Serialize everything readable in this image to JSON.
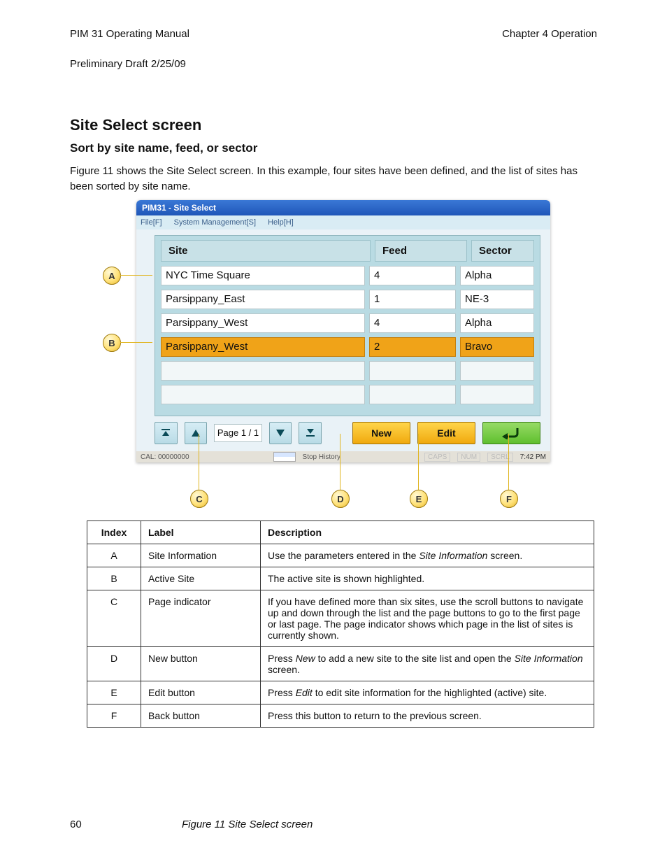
{
  "header": {
    "doc_title": "PIM 31 Operating Manual",
    "chapter": "Chapter 4   Operation",
    "doc_id": "Preliminary Draft 2/25/09"
  },
  "section": {
    "heading": "Site Select screen",
    "subheading": "Sort by site name, feed, or sector",
    "body1": "Figure 11 shows the Site Select screen. In this example, four sites have been defined, and the list of sites has",
    "body2": "been sorted by site name."
  },
  "window": {
    "title": "PIM31 - Site Select",
    "menus": {
      "file": "File[F]",
      "sys": "System Management[S]",
      "help": "Help[H]"
    },
    "columns": {
      "site": "Site",
      "feed": "Feed",
      "sector": "Sector"
    },
    "rows": [
      {
        "site": "NYC Time Square",
        "feed": "4",
        "sector": "Alpha",
        "selected": false
      },
      {
        "site": "Parsippany_East",
        "feed": "1",
        "sector": "NE-3",
        "selected": false
      },
      {
        "site": "Parsippany_West",
        "feed": "4",
        "sector": "Alpha",
        "selected": false
      },
      {
        "site": "Parsippany_West",
        "feed": "2",
        "sector": "Bravo",
        "selected": true
      },
      {
        "site": "",
        "feed": "",
        "sector": "",
        "empty": true
      },
      {
        "site": "",
        "feed": "",
        "sector": "",
        "empty": true
      }
    ],
    "pager": "Page 1 / 1",
    "buttons": {
      "new": "New",
      "edit": "Edit"
    },
    "status": {
      "cal": "CAL: 00000000",
      "stop": "Stop History",
      "caps": "CAPS",
      "num": "NUM",
      "scrl": "SCRL",
      "time": "7:42 PM"
    }
  },
  "callouts": {
    "columns": {
      "idx": "Index",
      "label": "Label",
      "desc": "Description"
    },
    "rows": [
      {
        "idx": "A",
        "label": "Site Information",
        "desc": "Use the parameters entered in the <span class='emph'>Site Information</span> screen."
      },
      {
        "idx": "B",
        "label": "Active Site",
        "desc": "The active site is shown highlighted."
      },
      {
        "idx": "C",
        "label": "Page indicator",
        "desc": "If you have defined more than six sites, use the scroll buttons to nav­igate up and down through the list and the page buttons to go to the first page or last page. The page indicator shows which page in the list of sites is currently shown."
      },
      {
        "idx": "D",
        "label": "New button",
        "desc": "Press <span class='emph'>New</span> to add a new site to the site list and open the <span class='emph'>Site Informa­tion</span> screen."
      },
      {
        "idx": "E",
        "label": "Edit button",
        "desc": "Press <span class='emph'>Edit</span> to edit site information for the highlighted (active) site."
      },
      {
        "idx": "F",
        "label": "Back button",
        "desc": "Press this button to return to the previous screen."
      }
    ]
  },
  "footer": {
    "page": "60",
    "caption": "Figure 11 Site Select screen"
  }
}
